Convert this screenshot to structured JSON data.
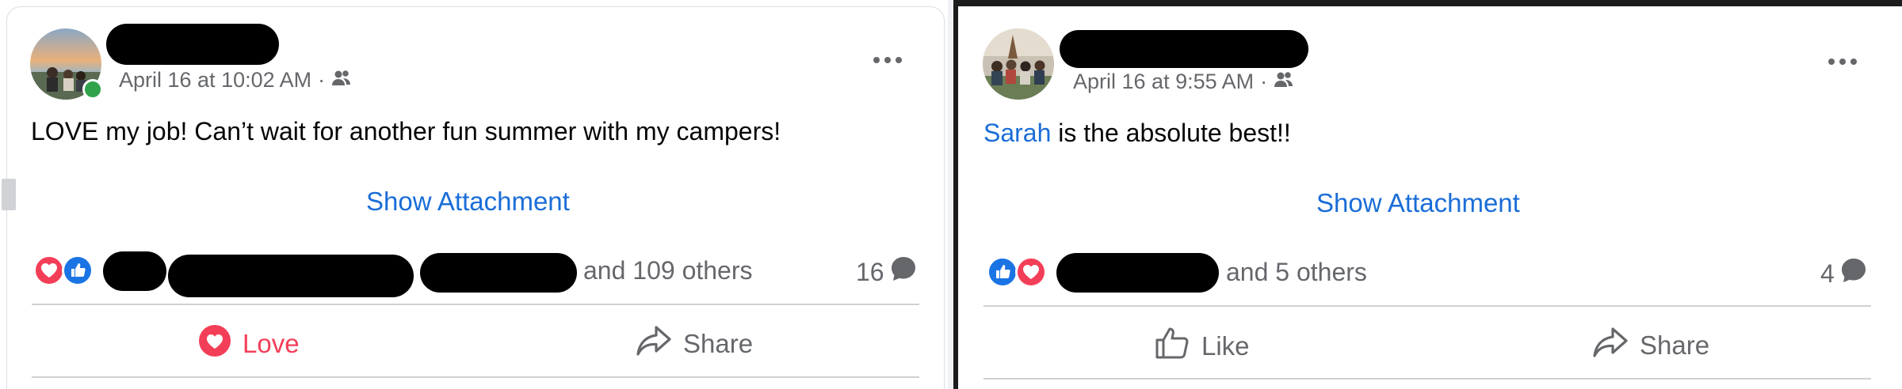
{
  "posts": [
    {
      "timestamp": "April 16 at 10:02 AM",
      "separator": "·",
      "audience_icon": "friends-icon",
      "text": "LOVE my job! Can’t wait for another fun summer with my campers!",
      "show_attachment": "Show Attachment",
      "reaction_icons": [
        "love-icon",
        "like-icon"
      ],
      "others": "and 109 others",
      "comment_count": "16",
      "actions": [
        {
          "label": "Love",
          "icon": "heart-icon"
        },
        {
          "label": "Share",
          "icon": "share-icon"
        }
      ],
      "online": true
    },
    {
      "timestamp": "April 16 at 9:55 AM",
      "separator": "·",
      "audience_icon": "friends-icon",
      "mention": "Sarah",
      "text_after_mention": " is the absolute best!!",
      "show_attachment": "Show Attachment",
      "reaction_icons": [
        "like-icon",
        "love-icon"
      ],
      "others": "and 5 others",
      "comment_count": "4",
      "actions": [
        {
          "label": "Like",
          "icon": "thumbs-up-icon"
        },
        {
          "label": "Share",
          "icon": "share-icon"
        }
      ],
      "online": false
    }
  ],
  "colors": {
    "link_blue": "#1a6dd8",
    "love_red": "#f33e58",
    "like_blue": "#1b74e4",
    "muted_text": "#65676b",
    "online_green": "#31a24c"
  }
}
